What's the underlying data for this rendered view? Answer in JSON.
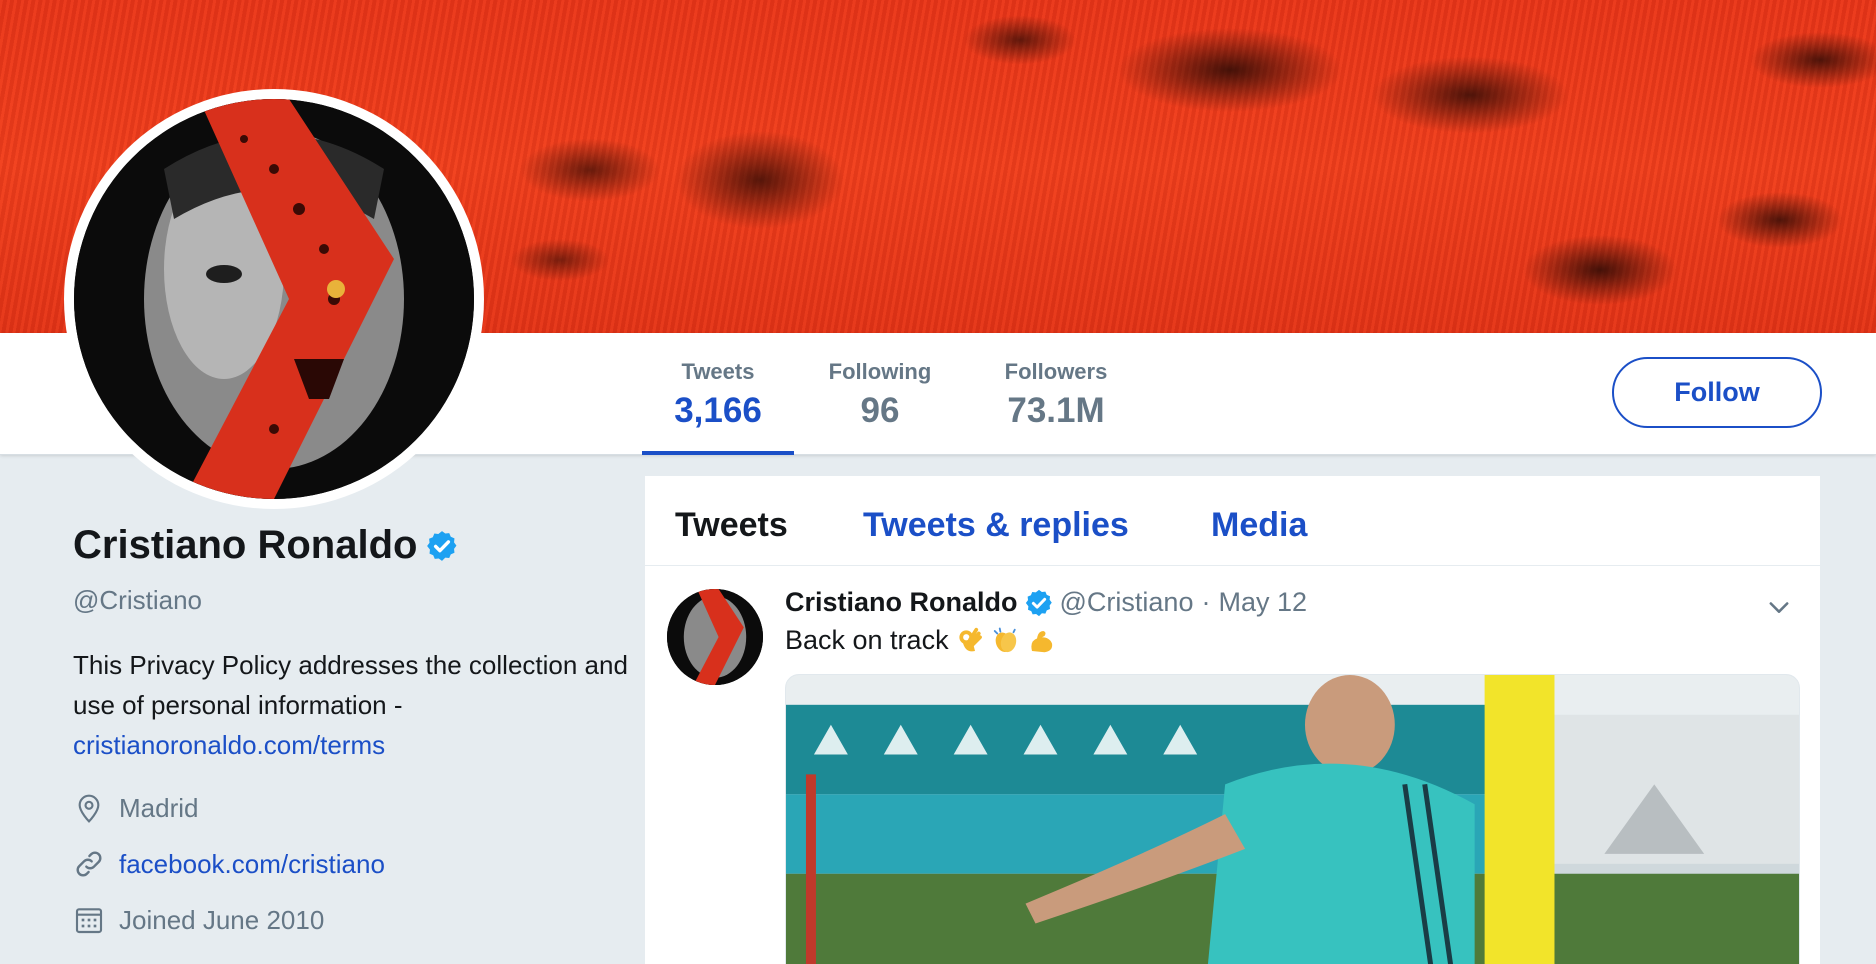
{
  "profile": {
    "name": "Cristiano Ronaldo",
    "handle": "@Cristiano",
    "bio_text": "This Privacy Policy addresses the collection and use of personal information - ",
    "bio_link": "cristianoronaldo.com/terms",
    "location": "Madrid",
    "website": "facebook.com/cristiano",
    "joined": "Joined June 2010"
  },
  "stats": [
    {
      "label": "Tweets",
      "value": "3,166"
    },
    {
      "label": "Following",
      "value": "96"
    },
    {
      "label": "Followers",
      "value": "73.1M"
    }
  ],
  "follow_label": "Follow",
  "tabs": [
    {
      "label": "Tweets"
    },
    {
      "label": "Tweets & replies"
    },
    {
      "label": "Media"
    }
  ],
  "tweet": {
    "author": "Cristiano Ronaldo",
    "handle": "@Cristiano",
    "separator": "·",
    "date": "May 12",
    "text": "Back on track"
  },
  "colors": {
    "accent": "#1b4fc7",
    "verified": "#1da1f2",
    "muted": "#657786",
    "background": "#e6ecf0",
    "banner": "#e8361a"
  },
  "icons": [
    "verified-badge-icon",
    "location-pin-icon",
    "link-icon",
    "calendar-icon",
    "chevron-down-icon",
    "ok-hand-emoji",
    "clapping-hands-emoji",
    "flexed-biceps-emoji"
  ]
}
